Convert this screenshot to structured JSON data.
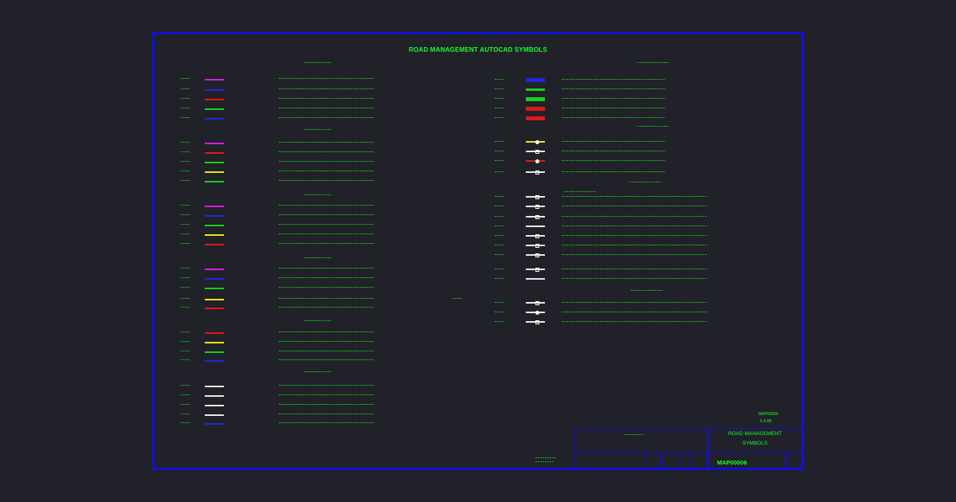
{
  "drawing": {
    "title": "ROAD MANAGEMENT AUTOCAD SYMBOLS"
  },
  "colors": {
    "background": "#212129",
    "frame": "#1010d8",
    "text": "#17ff2e",
    "magenta": "#d61fd6",
    "blue": "#2424e0",
    "red": "#e01818",
    "green": "#18d018",
    "yellow": "#e8e818",
    "white": "#e8e8e8"
  },
  "title_block": {
    "name_line1": "ROAD MANAGEMENT",
    "name_line2": "SYMBOLS",
    "drawing_number": "MAP00006",
    "ref_number": "MAP00006",
    "ref_date": "5-6-89"
  }
}
